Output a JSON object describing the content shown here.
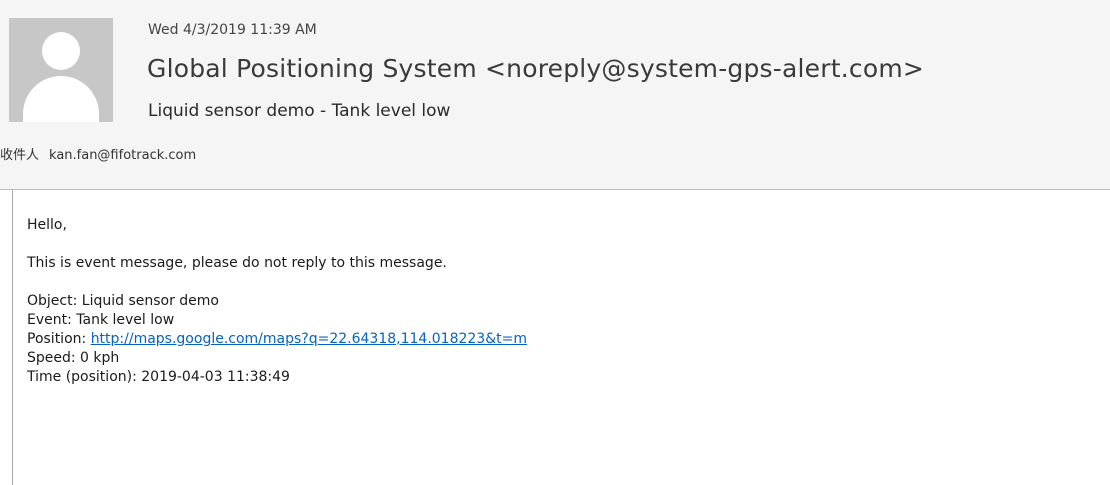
{
  "email": {
    "sent_date": "Wed 4/3/2019 11:39 AM",
    "sender": "Global Positioning System <noreply@system-gps-alert.com>",
    "subject": "Liquid sensor demo - Tank level low",
    "to_label": "收件人",
    "to_address": "kan.fan@fifotrack.com"
  },
  "body": {
    "greeting": "Hello,",
    "notice": "This is event message, please do not reply to this message.",
    "object_line": "Object: Liquid sensor demo",
    "event_line": "Event: Tank level low",
    "position_label": "Position: ",
    "position_link": "http://maps.google.com/maps?q=22.64318,114.018223&t=m",
    "speed_line": "Speed: 0 kph",
    "time_line": "Time (position): 2019-04-03 11:38:49"
  },
  "icons": {
    "avatar": "person-silhouette-icon"
  },
  "colors": {
    "header_bg": "#f5f5f5",
    "avatar_bg": "#c7c7c7",
    "link": "#0563c1"
  }
}
